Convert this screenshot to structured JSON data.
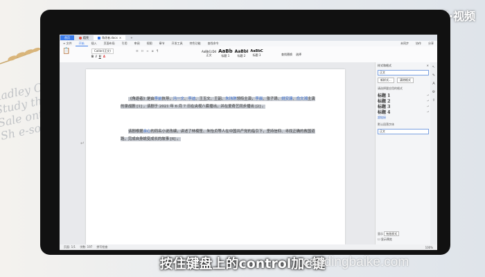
{
  "watermark": "天奇·视频",
  "subtitle": "按住键盘上的control加c键",
  "site_watermark": "caodingbaike.com",
  "tabs": [
    {
      "label": "首页",
      "kind": "home"
    },
    {
      "label": "稻壳",
      "kind": "pdf"
    },
    {
      "label": "角逐者.docx",
      "kind": "doc"
    },
    {
      "label": "+",
      "kind": "plus"
    }
  ],
  "menu": {
    "items": [
      "开始",
      "插入",
      "页面布局",
      "引用",
      "审阅",
      "视图",
      "章节",
      "开发工具",
      "特色功能",
      "查找命令"
    ],
    "active_index": 0,
    "right": [
      "未同步",
      "协作",
      "分享"
    ]
  },
  "ribbon": {
    "font_name": "Calibri(正文)",
    "styles": [
      {
        "sample": "AaBbCcDd",
        "name": "正文"
      },
      {
        "sample": "AaBb",
        "name": "标题 1"
      },
      {
        "sample": "AaBbI",
        "name": "标题 2"
      },
      {
        "sample": "AaBbC",
        "name": "标题 3"
      }
    ],
    "find_label": "查找替换",
    "select_label": "选择"
  },
  "document": {
    "para1_parts": [
      {
        "text": "《角逐者》是由",
        "hl": true
      },
      {
        "text": "李前",
        "hl": true,
        "blue": true
      },
      {
        "text": "执导，",
        "hl": true
      },
      {
        "text": "冯一文",
        "hl": true,
        "blue": true
      },
      {
        "text": "、",
        "hl": true
      },
      {
        "text": "李迪",
        "hl": true,
        "blue": true
      },
      {
        "text": "、王玉文、王韶、",
        "hl": true
      },
      {
        "text": "朱玮琪",
        "hl": true,
        "blue": true
      },
      {
        "text": "领衔主演，",
        "hl": true
      },
      {
        "text": "李晨",
        "hl": true,
        "blue": true
      },
      {
        "text": "、张子昂、",
        "hl": true
      },
      {
        "text": "姚安濂",
        "hl": true,
        "blue": true
      },
      {
        "text": "、",
        "hl": true
      },
      {
        "text": "俞文湘",
        "hl": true,
        "blue": true
      },
      {
        "text": "主演的谍战剧 [1] ，该剧于 2021 年 6 月 7 日在央视八套播出，并在爱奇艺同步播出 [2] 。",
        "hl": true
      }
    ],
    "para2_parts": [
      {
        "text": "该剧根据",
        "hl": true
      },
      {
        "text": "余心",
        "hl": true,
        "blue": true
      },
      {
        "text": "的同名小说改编，讲述了林楠笙、朱怡贞等人在中国共产党的指引下，坚持信仰、寻找正确的救国道路，完成自身蜕变成长的故事 [6] 。",
        "hl": true
      }
    ]
  },
  "side_panel": {
    "title": "样式和格式",
    "current_style": "正文",
    "new_style": "新样式...",
    "clear_format": "清除格式",
    "choose_label": "请选择要应用的格式",
    "headings": [
      "标题 1",
      "标题 2",
      "标题 3",
      "标题 4"
    ],
    "extra_items": [
      "超链接",
      "默认段落字体",
      "正文"
    ],
    "display_label": "显示",
    "display_value": "有效样式",
    "preview_label": "显示预览"
  },
  "statusbar": {
    "page": "页面: 1/1",
    "words": "字数: 197",
    "spell": "拼写检查",
    "zoom": "100%"
  }
}
